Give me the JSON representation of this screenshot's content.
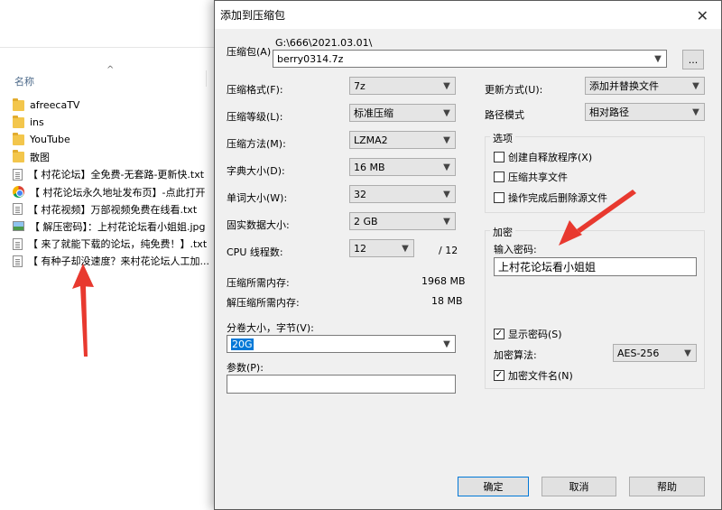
{
  "explorer": {
    "column_name": "名称",
    "files": [
      {
        "icon": "folder",
        "name": "afreecaTV"
      },
      {
        "icon": "folder",
        "name": "ins"
      },
      {
        "icon": "folder",
        "name": "YouTube"
      },
      {
        "icon": "folder",
        "name": "散图"
      },
      {
        "icon": "txt",
        "name": "【 村花论坛】全免费-无套路-更新快.txt"
      },
      {
        "icon": "chrome",
        "name": "【 村花论坛永久地址发布页】-点此打开"
      },
      {
        "icon": "txt",
        "name": "【 村花视频】万部视频免费在线看.txt"
      },
      {
        "icon": "image",
        "name": "【 解压密码】：上村花论坛看小姐姐.jpg"
      },
      {
        "icon": "txt",
        "name": "【 来了就能下载的论坛，纯免费！】.txt"
      },
      {
        "icon": "txt",
        "name": "【 有种子却没速度？来村花论坛人工加..."
      }
    ],
    "arrow_color": "#e8392f"
  },
  "dialog": {
    "title": "添加到压缩包",
    "archive": {
      "label": "压缩包(A)",
      "path": "G:\\666\\2021.03.01\\",
      "filename": "berry0314.7z",
      "browse_label": "..."
    },
    "left": {
      "format": {
        "label": "压缩格式(F):",
        "value": "7z"
      },
      "level": {
        "label": "压缩等级(L):",
        "value": "标准压缩"
      },
      "method": {
        "label": "压缩方法(M):",
        "value": "LZMA2"
      },
      "dict": {
        "label": "字典大小(D):",
        "value": "16 MB"
      },
      "word": {
        "label": "单词大小(W):",
        "value": "32"
      },
      "solid": {
        "label": "固实数据大小:",
        "value": "2 GB"
      },
      "threads": {
        "label": "CPU 线程数:",
        "value": "12",
        "max": "/ 12"
      },
      "mem_compress": {
        "label": "压缩所需内存:",
        "value": "1968 MB"
      },
      "mem_decompress": {
        "label": "解压缩所需内存:",
        "value": "18 MB"
      },
      "split": {
        "label": "分卷大小，字节(V):",
        "value": "20G"
      },
      "params": {
        "label": "参数(P):",
        "value": ""
      }
    },
    "right": {
      "update": {
        "label": "更新方式(U):",
        "value": "添加并替换文件"
      },
      "pathmode": {
        "label": "路径模式",
        "value": "相对路径"
      },
      "options": {
        "title": "选项",
        "sfx": "创建自释放程序(X)",
        "shared": "压缩共享文件",
        "delete": "操作完成后删除源文件"
      },
      "encryption": {
        "title": "加密",
        "password_label": "输入密码:",
        "password_value": "上村花论坛看小姐姐",
        "show_password": "显示密码(S)",
        "method_label": "加密算法:",
        "method_value": "AES-256",
        "encrypt_names": "加密文件名(N)"
      }
    },
    "buttons": {
      "ok": "确定",
      "cancel": "取消",
      "help": "帮助"
    }
  }
}
